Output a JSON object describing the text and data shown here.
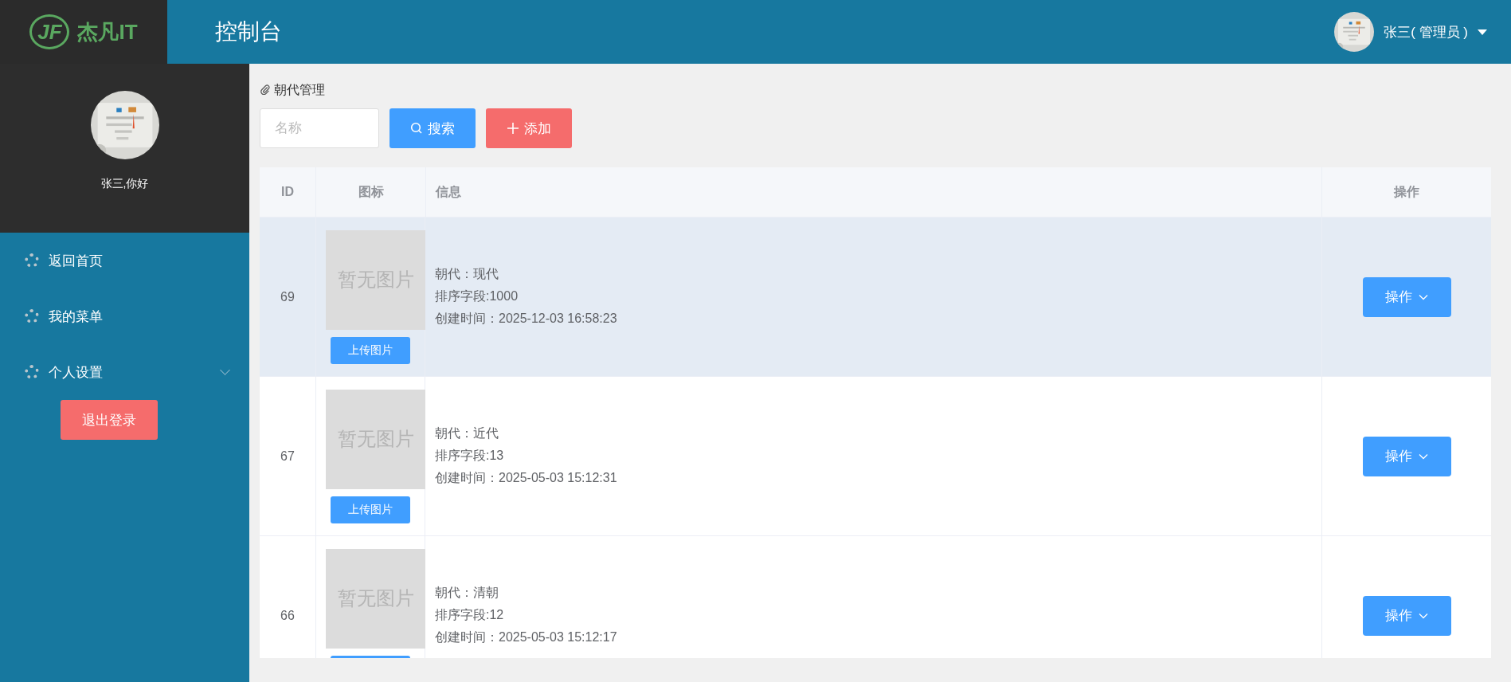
{
  "header": {
    "logo_mark": "JF",
    "logo_text": "杰凡IT",
    "title": "控制台",
    "user": "张三( 管理员 )"
  },
  "sidebar": {
    "greeting": "张三,你好",
    "items": [
      {
        "label": "返回首页",
        "expandable": false
      },
      {
        "label": "我的菜单",
        "expandable": false
      },
      {
        "label": "个人设置",
        "expandable": true
      }
    ],
    "logout": "退出登录"
  },
  "breadcrumb": "朝代管理",
  "toolbar": {
    "search_placeholder": "名称",
    "search_button": "搜索",
    "add_button": "添加"
  },
  "table": {
    "columns": [
      "ID",
      "图标",
      "信息",
      "操作"
    ],
    "rows": [
      {
        "id": "69",
        "image_placeholder": "暂无图片",
        "upload_button": "上传图片",
        "lines": [
          "朝代：现代",
          "排序字段:1000",
          "创建时间：2025-12-03 16:58:23"
        ],
        "action": "操作",
        "hovered": true
      },
      {
        "id": "67",
        "image_placeholder": "暂无图片",
        "upload_button": "上传图片",
        "lines": [
          "朝代：近代",
          "排序字段:13",
          "创建时间：2025-05-03 15:12:31"
        ],
        "action": "操作",
        "hovered": false
      },
      {
        "id": "66",
        "image_placeholder": "暂无图片",
        "lines": [
          "朝代：清朝",
          "排序字段:12",
          "创建时间：2025-05-03 15:12:17"
        ],
        "action": "操作",
        "hovered": false
      }
    ]
  }
}
